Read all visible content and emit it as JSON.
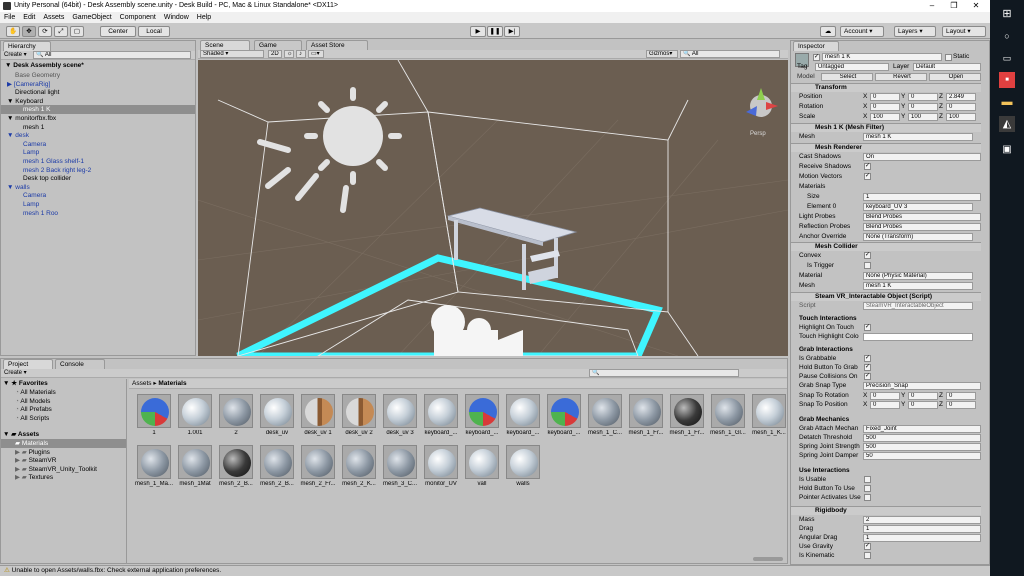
{
  "window": {
    "title": "Unity Personal (64bit) - Desk Assembly scene.unity - Desk Build - PC, Mac & Linux Standalone* <DX11>"
  },
  "menu": [
    "File",
    "Edit",
    "Assets",
    "GameObject",
    "Component",
    "Window",
    "Help"
  ],
  "toolbar": {
    "center": "Center",
    "local": "Local",
    "account": "Account",
    "layers": "Layers",
    "layout": "Layout"
  },
  "hierarchy": {
    "tab": "Hierarchy",
    "create": "Create",
    "search": "All",
    "scene": "Desk Assembly scene*",
    "items": [
      {
        "label": "Base Geometry",
        "indent": 14,
        "style": "grey"
      },
      {
        "label": "[CameraRig]",
        "indent": 14,
        "style": "blue",
        "arrow": "▶"
      },
      {
        "label": "Directional light",
        "indent": 14,
        "style": ""
      },
      {
        "label": "Keyboard",
        "indent": 14,
        "style": "",
        "arrow": "▼"
      },
      {
        "label": "mesh 1 K",
        "indent": 22,
        "style": "sel"
      },
      {
        "label": "monitorfbx.fbx",
        "indent": 14,
        "style": "",
        "arrow": "▼"
      },
      {
        "label": "mesh 1",
        "indent": 22,
        "style": ""
      },
      {
        "label": "desk",
        "indent": 14,
        "style": "blue",
        "arrow": "▼"
      },
      {
        "label": "Camera",
        "indent": 22,
        "style": "blue"
      },
      {
        "label": "Lamp",
        "indent": 22,
        "style": "blue"
      },
      {
        "label": "mesh 1 Glass shelf-1",
        "indent": 22,
        "style": "blue"
      },
      {
        "label": "mesh 2 Back right leg-2",
        "indent": 22,
        "style": "blue"
      },
      {
        "label": "Desk top collider",
        "indent": 22,
        "style": ""
      },
      {
        "label": "walls",
        "indent": 14,
        "style": "blue",
        "arrow": "▼"
      },
      {
        "label": "Camera",
        "indent": 22,
        "style": "blue"
      },
      {
        "label": "Lamp",
        "indent": 22,
        "style": "blue"
      },
      {
        "label": "mesh 1 Roo",
        "indent": 22,
        "style": "blue"
      }
    ]
  },
  "scene": {
    "tabs": [
      "Scene",
      "Game",
      "Asset Store"
    ],
    "shading": "Shaded",
    "mode2d": "2D",
    "gizmos": "Gizmos",
    "search": "All",
    "persp": "Persp"
  },
  "inspector": {
    "tab": "Inspector",
    "name": "mesh 1 K",
    "static": "Static",
    "tag_label": "Tag",
    "tag": "Untagged",
    "layer_label": "Layer",
    "layer": "Default",
    "model_label": "Model",
    "select": "Select",
    "revert": "Revert",
    "open": "Open",
    "transform": {
      "title": "Transform",
      "position": "Position",
      "rotation": "Rotation",
      "scale": "Scale",
      "pos": [
        "0",
        "0",
        "2.849"
      ],
      "rot": [
        "0",
        "0",
        "0"
      ],
      "scl": [
        "100",
        "100",
        "100"
      ]
    },
    "mesh_filter": {
      "title": "Mesh 1 K (Mesh Filter)",
      "mesh_label": "Mesh",
      "mesh": "mesh 1 K"
    },
    "mesh_renderer": {
      "title": "Mesh Renderer",
      "cast": "Cast Shadows",
      "cast_val": "On",
      "receive": "Receive Shadows",
      "motion": "Motion Vectors",
      "materials": "Materials",
      "size": "Size",
      "size_val": "1",
      "element": "Element 0",
      "element_val": "keyboard_UV 3",
      "light": "Light Probes",
      "light_val": "Blend Probes",
      "refl": "Reflection Probes",
      "refl_val": "Blend Probes",
      "anchor": "Anchor Override",
      "anchor_val": "None (Transform)"
    },
    "mesh_collider": {
      "title": "Mesh Collider",
      "convex": "Convex",
      "trigger": "Is Trigger",
      "material": "Material",
      "material_val": "None (Physic Material)",
      "mesh": "Mesh",
      "mesh_val": "mesh 1 K"
    },
    "steam": {
      "title": "Steam VR_Interactable Object (Script)",
      "script": "Script",
      "script_val": "SteamVR_InteractableObject",
      "touch": "Touch Interactions",
      "hl": "Highlight On Touch",
      "hlc": "Touch Highlight Colo",
      "grab": "Grab Interactions",
      "grabbable": "Is Grabbable",
      "hold": "Hold Button To Grab",
      "pause": "Pause Collisions On",
      "snap": "Grab Snap Type",
      "snap_val": "Precision_Snap",
      "snaprot": "Snap To Rotation",
      "snappos": "Snap To Position",
      "mech": "Grab Mechanics",
      "attach": "Grab Attach Mechan",
      "attach_val": "Fixed_Joint",
      "detatch": "Detatch Threshold",
      "detatch_val": "500",
      "strength": "Spring Joint Strength",
      "strength_val": "500",
      "damper": "Spring Joint Damper",
      "damper_val": "50",
      "use": "Use Interactions",
      "usable": "Is Usable",
      "holduse": "Hold Button To Use",
      "pointer": "Pointer Activates Use"
    },
    "rigidbody": {
      "title": "Rigidbody",
      "mass": "Mass",
      "mass_val": "2",
      "drag": "Drag",
      "drag_val": "1",
      "adrag": "Angular Drag",
      "adrag_val": "1",
      "grav": "Use Gravity",
      "kin": "Is Kinematic"
    }
  },
  "project": {
    "tabs": [
      "Project",
      "Console"
    ],
    "create": "Create",
    "favorites": "Favorites",
    "fav_items": [
      "All Materials",
      "All Models",
      "All Prefabs",
      "All Scripts"
    ],
    "assets": "Assets",
    "asset_items": [
      "Materials",
      "Plugins",
      "SteamVR",
      "SteamVR_Unity_Toolkit",
      "Textures"
    ],
    "breadcrumb_root": "Assets",
    "breadcrumb_leaf": "Materials",
    "materials": [
      {
        "label": "1",
        "kind": "rgb"
      },
      {
        "label": "1.001",
        "kind": "light"
      },
      {
        "label": "2",
        "kind": "mid"
      },
      {
        "label": "desk_uv",
        "kind": "light"
      },
      {
        "label": "desk_uv 1",
        "kind": "wood"
      },
      {
        "label": "desk_uv 2",
        "kind": "wood"
      },
      {
        "label": "desk_uv 3",
        "kind": "light"
      },
      {
        "label": "keyboard_...",
        "kind": "light"
      },
      {
        "label": "keyboard_...",
        "kind": "rgb"
      },
      {
        "label": "keyboard_...",
        "kind": "light"
      },
      {
        "label": "keyboard_...",
        "kind": "rgb"
      },
      {
        "label": "mesh_1_C...",
        "kind": "mid"
      },
      {
        "label": "mesh_1_Fr...",
        "kind": "mid"
      },
      {
        "label": "mesh_1_Fr...",
        "kind": "dark"
      },
      {
        "label": "mesh_1_Gl...",
        "kind": "mid"
      },
      {
        "label": "mesh_1_K...",
        "kind": "light"
      },
      {
        "label": "mesh_1_Ma...",
        "kind": "mid"
      },
      {
        "label": "mesh_1Mat",
        "kind": "mid"
      },
      {
        "label": "mesh_2_B...",
        "kind": "dark"
      },
      {
        "label": "mesh_2_B...",
        "kind": "mid"
      },
      {
        "label": "mesh_2_Fr...",
        "kind": "mid"
      },
      {
        "label": "mesh_2_K...",
        "kind": "mid"
      },
      {
        "label": "mesh_3_C...",
        "kind": "mid"
      },
      {
        "label": "monitor_UV",
        "kind": "light"
      },
      {
        "label": "vall",
        "kind": "light"
      },
      {
        "label": "walls",
        "kind": "light"
      }
    ]
  },
  "status": "Unable to open Assets/walls.fbx: Check external application preferences.",
  "colors": {
    "scene_bg": "#6b5e51",
    "highlight": "#3ff5ff",
    "wire": "#e8e8e8"
  }
}
